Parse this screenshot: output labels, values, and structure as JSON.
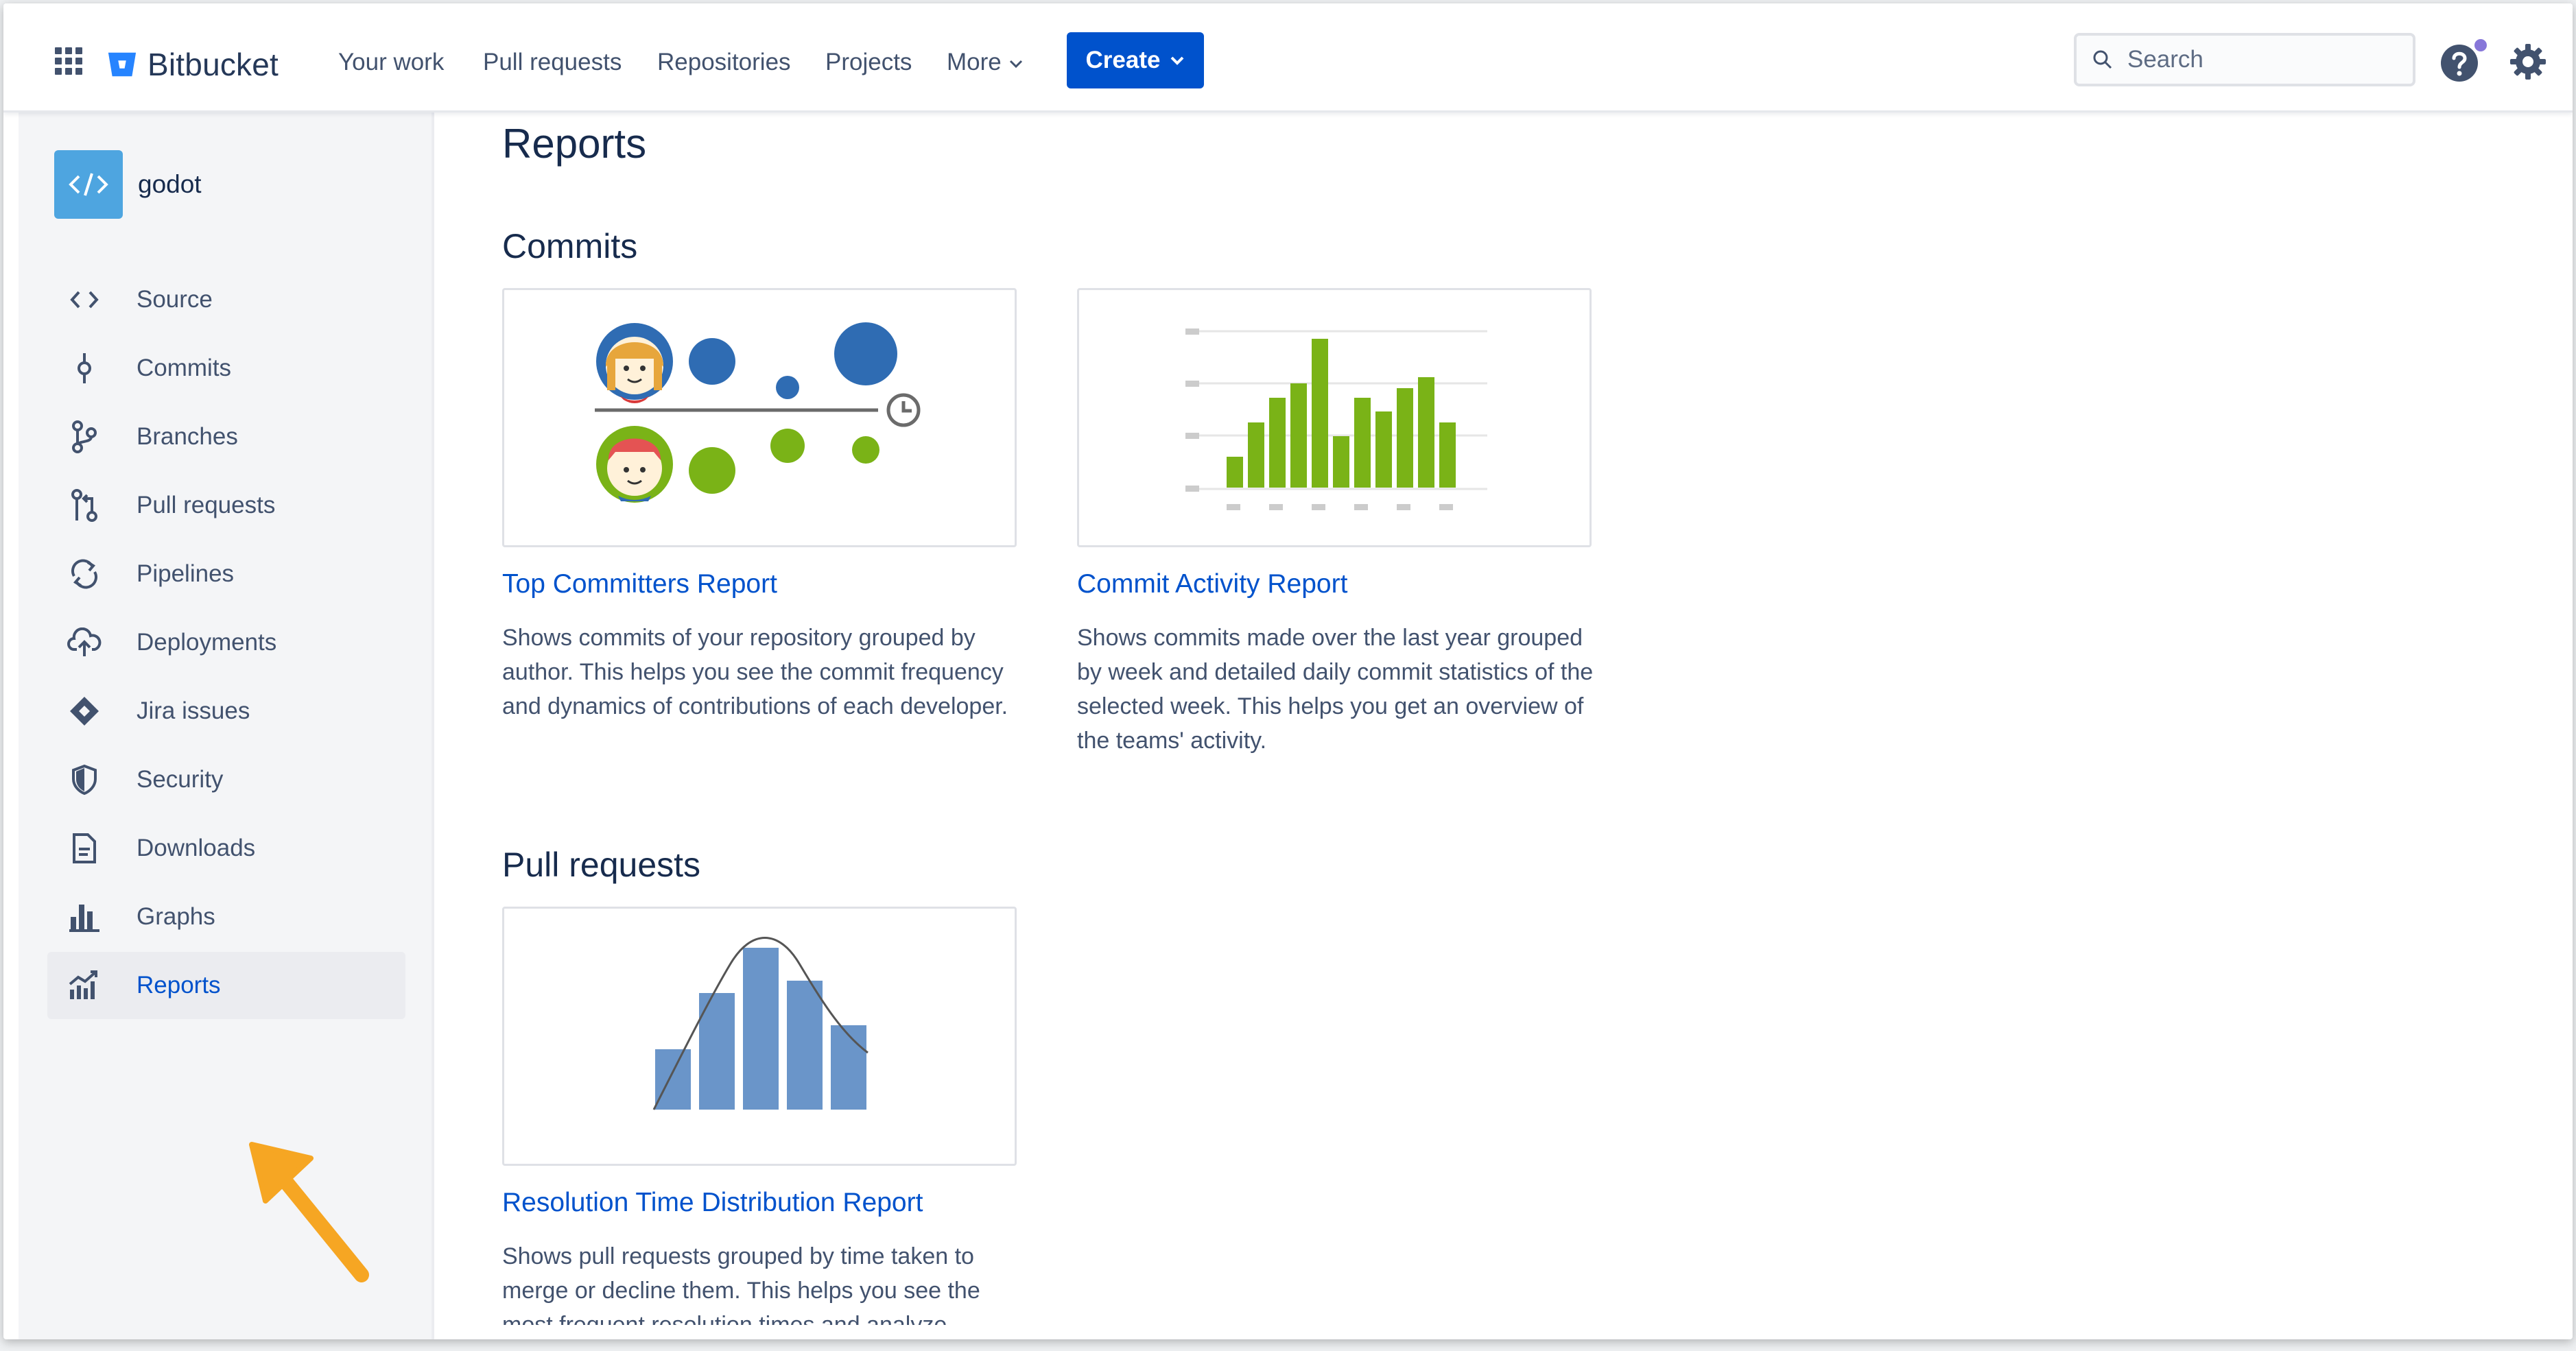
{
  "topnav": {
    "logo_text": "Bitbucket",
    "items": [
      "Your work",
      "Pull requests",
      "Repositories",
      "Projects",
      "More"
    ],
    "create_label": "Create",
    "search_placeholder": "Search"
  },
  "sidebar": {
    "repo_name": "godot",
    "items": [
      {
        "label": "Source",
        "icon": "code-icon"
      },
      {
        "label": "Commits",
        "icon": "commit-icon"
      },
      {
        "label": "Branches",
        "icon": "branch-icon"
      },
      {
        "label": "Pull requests",
        "icon": "pull-request-icon"
      },
      {
        "label": "Pipelines",
        "icon": "pipelines-icon"
      },
      {
        "label": "Deployments",
        "icon": "cloud-upload-icon"
      },
      {
        "label": "Jira issues",
        "icon": "jira-icon"
      },
      {
        "label": "Security",
        "icon": "shield-icon"
      },
      {
        "label": "Downloads",
        "icon": "document-icon"
      },
      {
        "label": "Graphs",
        "icon": "bar-graph-icon"
      },
      {
        "label": "Reports",
        "icon": "line-graph-icon",
        "active": true
      }
    ]
  },
  "main": {
    "title": "Reports",
    "sections": [
      {
        "title": "Commits",
        "cards": [
          {
            "title": "Top Committers Report",
            "description": "Shows commits of your repository grouped by author. This helps you see the commit frequency and dynamics of contributions of each developer."
          },
          {
            "title": "Commit Activity Report",
            "description": "Shows commits made over the last year grouped by week and detailed daily commit statistics of the selected week. This helps you get an overview of the teams' activity."
          }
        ]
      },
      {
        "title": "Pull requests",
        "cards": [
          {
            "title": "Resolution Time Distribution Report",
            "description": "Shows pull requests grouped by time taken to merge or decline them. This helps you see the most frequent resolution times and analyze"
          }
        ]
      }
    ]
  },
  "colors": {
    "brand_blue": "#0052cc",
    "sidebar_bg": "#f4f5f7",
    "annotation_arrow": "#f6a623"
  }
}
